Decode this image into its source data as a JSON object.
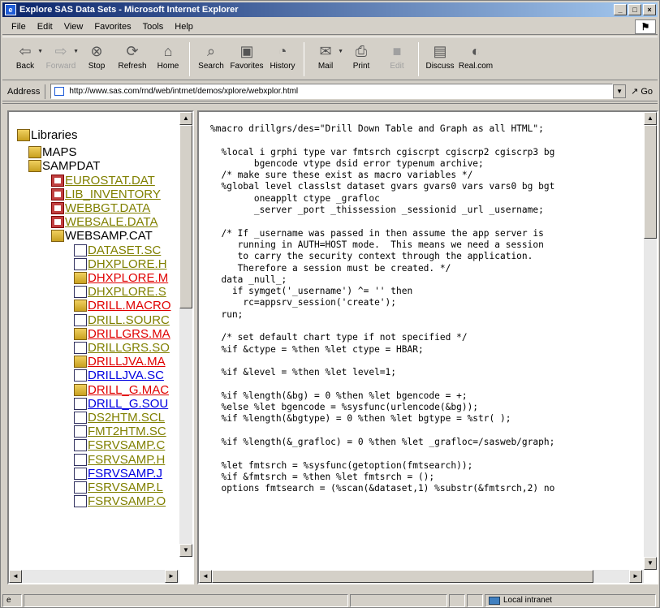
{
  "window": {
    "title": "Explore SAS Data Sets - Microsoft Internet Explorer"
  },
  "menu": [
    "File",
    "Edit",
    "View",
    "Favorites",
    "Tools",
    "Help"
  ],
  "toolbar": {
    "back": "Back",
    "forward": "Forward",
    "stop": "Stop",
    "refresh": "Refresh",
    "home": "Home",
    "search": "Search",
    "favorites": "Favorites",
    "history": "History",
    "mail": "Mail",
    "print": "Print",
    "edit": "Edit",
    "discuss": "Discuss",
    "realcom": "Real.com"
  },
  "address": {
    "label": "Address",
    "url": "http://www.sas.com/rnd/web/intrnet/demos/xplore/webxplor.html",
    "go": "Go"
  },
  "tree": [
    {
      "label": "Libraries",
      "icon": "folder-open-icon",
      "color": "black",
      "link": false
    },
    {
      "label": "MAPS",
      "icon": "folder-icon",
      "color": "black",
      "link": false
    },
    {
      "label": "SAMPDAT",
      "icon": "folder-open-icon",
      "color": "black",
      "link": false
    },
    {
      "label": "EUROSTAT.DAT",
      "icon": "dataset-icon",
      "color": "olive",
      "link": true
    },
    {
      "label": "LIB_INVENTORY",
      "icon": "dataset-icon",
      "color": "olive",
      "link": true
    },
    {
      "label": "WEBBGT.DATA",
      "icon": "dataset-icon",
      "color": "olive",
      "link": true
    },
    {
      "label": "WEBSALE.DATA",
      "icon": "dataset-icon",
      "color": "olive",
      "link": true
    },
    {
      "label": "WEBSAMP.CAT",
      "icon": "catalog-open-icon",
      "color": "black",
      "link": false
    },
    {
      "label": "DATASET.SC",
      "icon": "scl-entry-icon",
      "color": "olive",
      "link": true
    },
    {
      "label": "DHXPLORE.H",
      "icon": "html-entry-icon",
      "color": "olive",
      "link": true
    },
    {
      "label": "DHXPLORE.M",
      "icon": "macro-entry-icon",
      "color": "red",
      "link": true
    },
    {
      "label": "DHXPLORE.S",
      "icon": "source-entry-icon",
      "color": "olive",
      "link": true
    },
    {
      "label": "DRILL.MACRO",
      "icon": "macro-entry-icon",
      "color": "red",
      "link": true
    },
    {
      "label": "DRILL.SOURC",
      "icon": "source-entry-icon",
      "color": "olive",
      "link": true
    },
    {
      "label": "DRILLGRS.MA",
      "icon": "macro-entry-icon",
      "color": "red",
      "link": true
    },
    {
      "label": "DRILLGRS.SO",
      "icon": "source-entry-icon",
      "color": "olive",
      "link": true
    },
    {
      "label": "DRILLJVA.MA",
      "icon": "macro-entry-icon",
      "color": "red",
      "link": true
    },
    {
      "label": "DRILLJVA.SC",
      "icon": "source-entry-icon",
      "color": "blue",
      "link": true
    },
    {
      "label": "DRILL_G.MAC",
      "icon": "macro-entry-icon",
      "color": "red",
      "link": true
    },
    {
      "label": "DRILL_G.SOU",
      "icon": "source-entry-icon",
      "color": "blue",
      "link": true
    },
    {
      "label": "DS2HTM.SCL",
      "icon": "scl-entry-icon",
      "color": "olive",
      "link": true
    },
    {
      "label": "FMT2HTM.SC",
      "icon": "source-entry-icon",
      "color": "olive",
      "link": true
    },
    {
      "label": "FSRVSAMP.C",
      "icon": "frame-entry-icon",
      "color": "olive",
      "link": true
    },
    {
      "label": "FSRVSAMP.H",
      "icon": "html-entry-icon",
      "color": "olive",
      "link": true
    },
    {
      "label": "FSRVSAMP.J",
      "icon": "frame-entry-icon",
      "color": "blue",
      "link": true
    },
    {
      "label": "FSRVSAMP.L",
      "icon": "log-entry-icon",
      "color": "olive",
      "link": true
    },
    {
      "label": "FSRVSAMP.O",
      "icon": "output-entry-icon",
      "color": "olive",
      "link": true
    }
  ],
  "code": [
    "%macro drillgrs/des=\"Drill Down Table and Graph as all HTML\";",
    "",
    "  %local i grphi type var fmtsrch cgiscrpt cgiscrp2 cgiscrp3 bg",
    "        bgencode vtype dsid error typenum archive;",
    "  /* make sure these exist as macro variables */",
    "  %global level classlst dataset gvars gvars0 vars vars0 bg bgt",
    "        oneapplt ctype _grafloc",
    "        _server _port _thissession _sessionid _url _username;",
    "",
    "  /* If _username was passed in then assume the app server is",
    "     running in AUTH=HOST mode.  This means we need a session",
    "     to carry the security context through the application.",
    "     Therefore a session must be created. */",
    "  data _null_;",
    "    if symget('_username') ^= '' then",
    "      rc=appsrv_session('create');",
    "  run;",
    "",
    "  /* set default chart type if not specified */",
    "  %if &ctype = %then %let ctype = HBAR;",
    "",
    "  %if &level = %then %let level=1;",
    "",
    "  %if %length(&bg) = 0 %then %let bgencode = +;",
    "  %else %let bgencode = %sysfunc(urlencode(&bg));",
    "  %if %length(&bgtype) = 0 %then %let bgtype = %str( );",
    "",
    "  %if %length(&_grafloc) = 0 %then %let _grafloc=/sasweb/graph;",
    "",
    "  %let fmtsrch = %sysfunc(getoption(fmtsearch));",
    "  %if &fmtsrch = %then %let fmtsrch = ();",
    "  options fmtsearch = (%scan(&dataset,1) %substr(&fmtsrch,2) no"
  ],
  "status": {
    "zone": "Local intranet"
  }
}
